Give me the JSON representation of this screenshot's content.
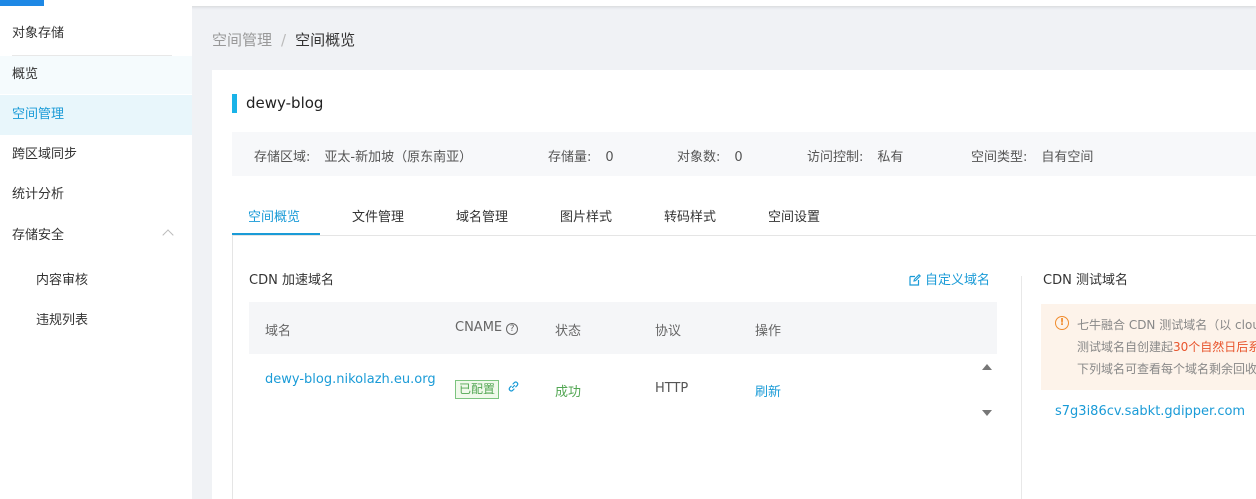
{
  "sidebar": {
    "title": "对象存储",
    "items": [
      {
        "label": "概览"
      },
      {
        "label": "空间管理"
      },
      {
        "label": "跨区域同步"
      },
      {
        "label": "统计分析"
      },
      {
        "label": "存储安全"
      },
      {
        "label": "内容审核"
      },
      {
        "label": "违规列表"
      }
    ]
  },
  "breadcrumb": {
    "parent": "空间管理",
    "separator": "/",
    "current": "空间概览"
  },
  "bucket": {
    "name": "dewy-blog",
    "region_label": "存储区域:",
    "region_value": "亚太-新加坡（原东南亚）",
    "storage_label": "存储量:",
    "storage_value": "0",
    "objects_label": "对象数:",
    "objects_value": "0",
    "access_label": "访问控制:",
    "access_value": "私有",
    "type_label": "空间类型:",
    "type_value": "自有空间"
  },
  "tabs": [
    {
      "label": "空间概览"
    },
    {
      "label": "文件管理"
    },
    {
      "label": "域名管理"
    },
    {
      "label": "图片样式"
    },
    {
      "label": "转码样式"
    },
    {
      "label": "空间设置"
    }
  ],
  "cdn": {
    "title": "CDN 加速域名",
    "custom_link": "自定义域名",
    "headers": {
      "domain": "域名",
      "cname": "CNAME",
      "status": "状态",
      "protocol": "协议",
      "action": "操作"
    },
    "rows": [
      {
        "domain": "dewy-blog.nikolazh.eu.org",
        "cname_badge": "已配置",
        "status": "成功",
        "protocol": "HTTP",
        "action": "刷新"
      }
    ]
  },
  "test_domain": {
    "title": "CDN 测试域名",
    "notice_line1": "七牛融合 CDN 测试域名（以 clou",
    "notice_line2_prefix": "测试域名自创建起",
    "notice_line2_highlight": "30个自然日后",
    "notice_line2_suffix": "系",
    "notice_line3": "下列域名可查看每个域名剩余回收",
    "domain": "s7g3i86cv.sabkt.gdipper.com"
  },
  "colors": {
    "accent": "#1a9bd7",
    "success": "#52a653",
    "warning": "#f08c2e",
    "danger": "#e8542c"
  }
}
